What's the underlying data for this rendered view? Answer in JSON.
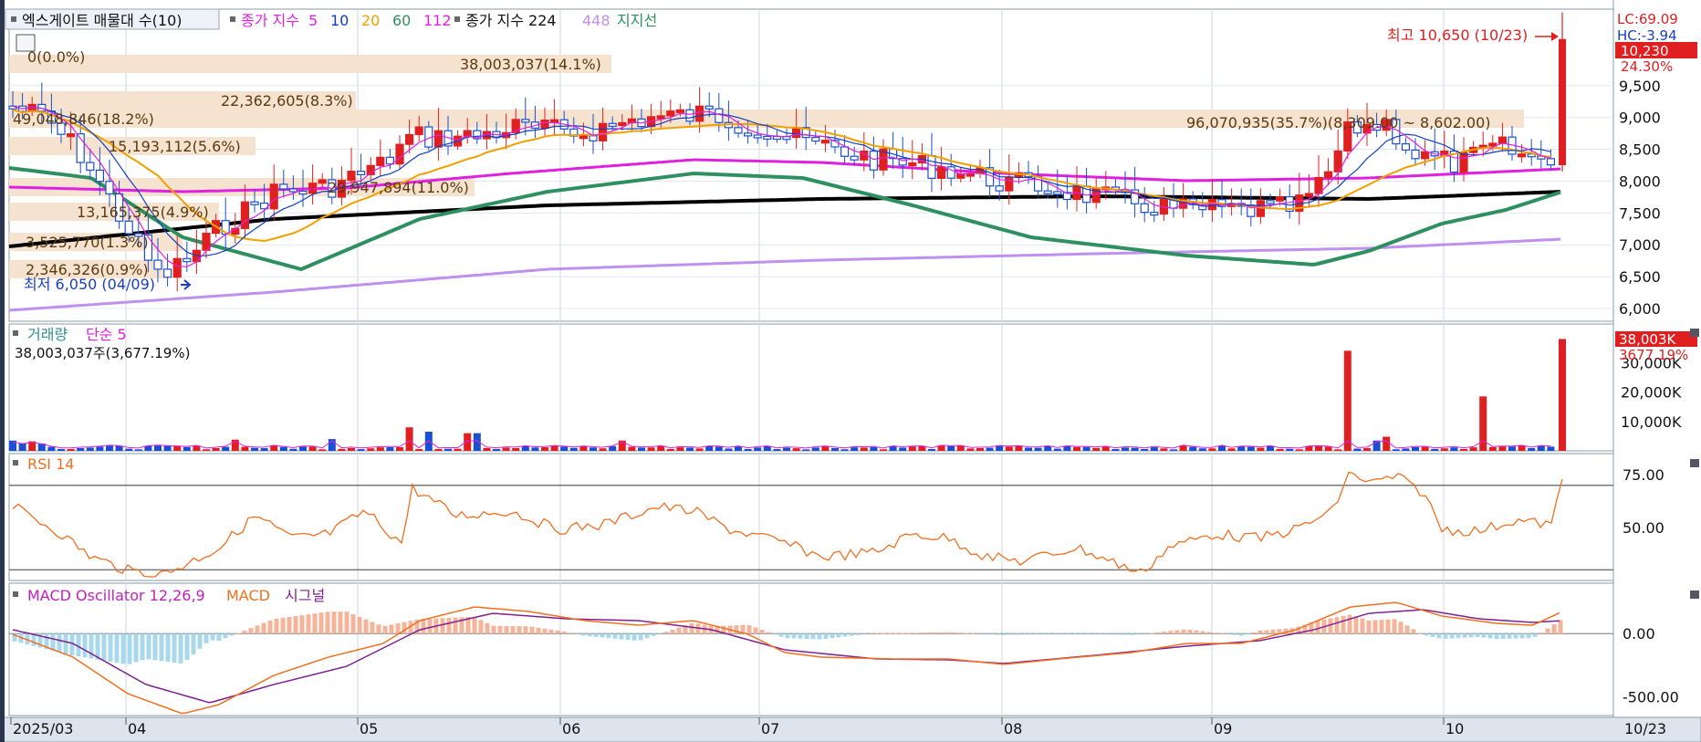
{
  "header": {
    "indicator_box": "엑스게이트 매물대 수(10)",
    "ma_title": "종가 지수",
    "ma_periods": [
      {
        "label": "5",
        "color": "#e020e0"
      },
      {
        "label": "10",
        "color": "#1040c0"
      },
      {
        "label": "20",
        "color": "#f0a000"
      },
      {
        "label": "60",
        "color": "#2e9060"
      },
      {
        "label": "112",
        "color": "#e020e0"
      }
    ],
    "ma2_title": "종가 지수 224",
    "ma2_extra": "448",
    "support_label": "지지선"
  },
  "price_axis": {
    "ticks": [
      "9,500",
      "9,000",
      "8,500",
      "8,000",
      "7,500",
      "7,000",
      "6,500",
      "6,000"
    ],
    "lc": "LC:69.09",
    "hc": "HC:-3.94",
    "last_price": "10,230",
    "last_change": "24.30%"
  },
  "price_annotations": {
    "high": "최고 10,650 (10/23)",
    "low": "최저 6,050 (04/09)",
    "range": "96,070,935(35.7%)(8,309.00 ~ 8,602.00)"
  },
  "volume_profile": [
    {
      "label": "0(0.0%)"
    },
    {
      "label": "38,003,037(14.1%)"
    },
    {
      "label": "22,362,605(8.3%)"
    },
    {
      "label": "49,048,846(18.2%)"
    },
    {
      "label": "15,193,112(5.6%)"
    },
    {
      "label": "29,947,894(11.0%)"
    },
    {
      "label": "13,165,375(4.9%)"
    },
    {
      "label": "3,525,770(1.3%)"
    },
    {
      "label": "2,346,326(0.9%)"
    }
  ],
  "volume_panel": {
    "title": "거래량",
    "ma_label": "단순 5",
    "info": "38,003,037주(3,677.19%)",
    "ticks": [
      "30,000K",
      "20,000K",
      "10,000K"
    ],
    "last_value": "38,003K",
    "last_pct": "3677.19%"
  },
  "rsi_panel": {
    "title": "RSI 14",
    "ticks": [
      "75.00",
      "50.00"
    ]
  },
  "macd_panel": {
    "title": "MACD Oscillator 12,26,9",
    "macd_label": "MACD",
    "signal_label": "시그널",
    "ticks": [
      "0.00",
      "-500.00"
    ]
  },
  "time_axis": {
    "labels": [
      "2025/03",
      "04",
      "05",
      "06",
      "07",
      "08",
      "09",
      "10"
    ],
    "last_label": "10/23"
  },
  "colors": {
    "up": "#e02020",
    "down": "#1a4fd0",
    "ma5": "#e020e0",
    "ma10": "#1040c0",
    "ma20": "#f0a000",
    "ma60": "#2e9060",
    "ma112": "#e020e0",
    "ma224": "#000000",
    "ma448": "#c090f0",
    "rsi": "#f07020",
    "macd": "#f07020",
    "signal": "#802090",
    "osc_pos": "#f5b49a",
    "osc_neg": "#a8d8ec",
    "profile": "#f5e2cc"
  },
  "chart_data": [
    {
      "type": "candlestick",
      "title": "엑스게이트 매물대 수(10)",
      "ylim": [
        5800,
        10700
      ],
      "ohlc_approx": [
        {
          "x": "2025/03",
          "close": 9000
        },
        {
          "x": "04",
          "close": 6600
        },
        {
          "x": "05",
          "close": 7700
        },
        {
          "x": "06",
          "close": 8600
        },
        {
          "x": "07",
          "close": 8000
        },
        {
          "x": "08",
          "close": 7200
        },
        {
          "x": "09",
          "close": 7100
        },
        {
          "x": "10",
          "close": 8000
        },
        {
          "x": "10/23",
          "close": 10230
        }
      ],
      "series": [
        {
          "name": "5",
          "values": [
            9000,
            6400,
            7800,
            8600,
            8000,
            7100,
            7100,
            8100,
            9000
          ]
        },
        {
          "name": "10",
          "values": [
            9000,
            6500,
            7700,
            8500,
            8100,
            7200,
            7100,
            8100,
            8600
          ]
        },
        {
          "name": "20",
          "values": [
            8800,
            6900,
            7600,
            8300,
            8200,
            7300,
            7200,
            8000,
            8200
          ]
        },
        {
          "name": "60",
          "values": [
            8000,
            7000,
            6900,
            7600,
            7800,
            7100,
            6800,
            7200,
            7700
          ]
        },
        {
          "name": "112",
          "values": [
            7600,
            7500,
            7500,
            7800,
            7900,
            7900,
            7700,
            7650,
            7800
          ]
        },
        {
          "name": "224",
          "values": [
            6700,
            6900,
            7100,
            7250,
            7350,
            7400,
            7400,
            7450,
            7500
          ]
        },
        {
          "name": "448",
          "values": [
            5900,
            6050,
            6200,
            6350,
            6450,
            6500,
            6550,
            6650,
            6750
          ]
        }
      ],
      "annotations": [
        "최고 10,650 (10/23)",
        "최저 6,050 (04/09)"
      ]
    },
    {
      "type": "bar",
      "title": "거래량",
      "ylim": [
        0,
        40000
      ],
      "unit": "K",
      "last": 38003
    },
    {
      "type": "line",
      "title": "RSI 14",
      "ylim": [
        25,
        85
      ],
      "x": [
        "2025/03",
        "04",
        "05",
        "06",
        "07",
        "08",
        "09",
        "10",
        "10/23"
      ],
      "values": [
        58,
        30,
        62,
        57,
        50,
        48,
        52,
        52,
        72
      ]
    },
    {
      "type": "bar",
      "title": "MACD Oscillator 12,26,9",
      "ylim": [
        -650,
        400
      ],
      "x": [
        "2025/03",
        "04",
        "05",
        "06",
        "07",
        "08",
        "09",
        "10",
        "10/23"
      ],
      "series": [
        {
          "name": "MACD",
          "values": [
            0,
            -550,
            -150,
            220,
            -50,
            -200,
            -220,
            240,
            200
          ]
        },
        {
          "name": "시그널",
          "values": [
            0,
            -450,
            -200,
            150,
            40,
            -200,
            -200,
            180,
            170
          ]
        }
      ]
    }
  ]
}
